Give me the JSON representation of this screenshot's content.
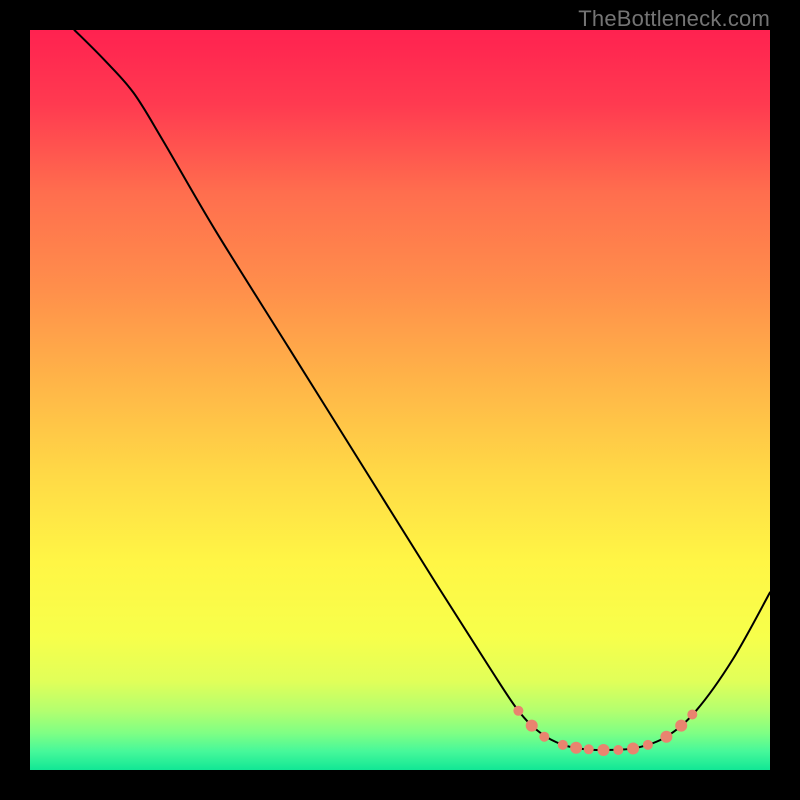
{
  "watermark": "TheBottleneck.com",
  "chart_data": {
    "type": "line",
    "title": "",
    "xlabel": "",
    "ylabel": "",
    "xlim": [
      0,
      100
    ],
    "ylim": [
      0,
      100
    ],
    "background_gradient_stops": [
      {
        "offset": 0.0,
        "color": "#ff2250"
      },
      {
        "offset": 0.1,
        "color": "#ff3a50"
      },
      {
        "offset": 0.22,
        "color": "#ff6e4e"
      },
      {
        "offset": 0.35,
        "color": "#ff8f4b"
      },
      {
        "offset": 0.48,
        "color": "#ffb648"
      },
      {
        "offset": 0.6,
        "color": "#ffd946"
      },
      {
        "offset": 0.72,
        "color": "#fff645"
      },
      {
        "offset": 0.82,
        "color": "#f7ff4b"
      },
      {
        "offset": 0.88,
        "color": "#e1ff59"
      },
      {
        "offset": 0.92,
        "color": "#b3ff6f"
      },
      {
        "offset": 0.95,
        "color": "#7fff84"
      },
      {
        "offset": 0.975,
        "color": "#46f89a"
      },
      {
        "offset": 1.0,
        "color": "#11e795"
      }
    ],
    "series": [
      {
        "name": "bottleneck-curve",
        "color": "#000000",
        "stroke_width": 2,
        "x": [
          6.0,
          10.0,
          14.0,
          18.0,
          25.0,
          35.0,
          45.0,
          55.0,
          62.0,
          66.0,
          69.0,
          72.0,
          75.0,
          78.0,
          82.0,
          86.0,
          90.0,
          95.0,
          100.0
        ],
        "y": [
          100.0,
          96.0,
          91.5,
          85.0,
          73.0,
          57.0,
          41.0,
          25.0,
          14.0,
          8.0,
          5.0,
          3.4,
          2.8,
          2.7,
          3.0,
          4.5,
          8.0,
          15.0,
          24.0
        ]
      }
    ],
    "markers": {
      "name": "optimal-zone-markers",
      "color": "#e9846f",
      "radius_min": 4,
      "radius_max": 7,
      "points": [
        {
          "x": 66.0,
          "y": 8.0,
          "r": 5
        },
        {
          "x": 67.8,
          "y": 6.0,
          "r": 6
        },
        {
          "x": 69.5,
          "y": 4.5,
          "r": 5
        },
        {
          "x": 72.0,
          "y": 3.4,
          "r": 5
        },
        {
          "x": 73.8,
          "y": 3.0,
          "r": 6
        },
        {
          "x": 75.5,
          "y": 2.8,
          "r": 5
        },
        {
          "x": 77.5,
          "y": 2.7,
          "r": 6
        },
        {
          "x": 79.5,
          "y": 2.7,
          "r": 5
        },
        {
          "x": 81.5,
          "y": 2.9,
          "r": 6
        },
        {
          "x": 83.5,
          "y": 3.4,
          "r": 5
        },
        {
          "x": 86.0,
          "y": 4.5,
          "r": 6
        },
        {
          "x": 88.0,
          "y": 6.0,
          "r": 6
        },
        {
          "x": 89.5,
          "y": 7.5,
          "r": 5
        }
      ]
    }
  }
}
